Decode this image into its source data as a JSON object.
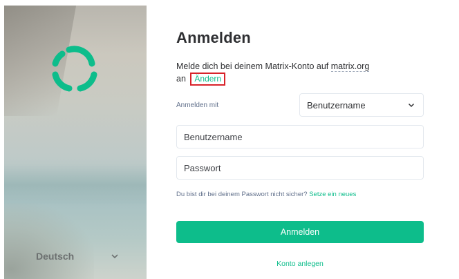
{
  "sidebar": {
    "language": {
      "label": "Deutsch",
      "icon": "chevron-down-icon"
    },
    "logo": {
      "icon": "element-logo-icon",
      "color": "#0dbd8b"
    }
  },
  "main": {
    "title": "Anmelden",
    "intro_text": "Melde dich bei deinem Matrix-Konto auf ",
    "server_name": "matrix.org",
    "intro_suffix": "an",
    "change_link": "Ändern",
    "login_with_label": "Anmelden mit",
    "login_method": {
      "selected": "Benutzername",
      "icon": "chevron-down-icon"
    },
    "username_placeholder": "Benutzername",
    "password_placeholder": "Passwort",
    "forgot_text": "Du bist dir bei deinem Passwort nicht sicher? ",
    "forgot_link": "Setze ein neues",
    "submit_label": "Anmelden",
    "create_account_label": "Konto anlegen"
  },
  "colors": {
    "accent": "#0dbd8b",
    "highlight_border": "#d8232a"
  }
}
